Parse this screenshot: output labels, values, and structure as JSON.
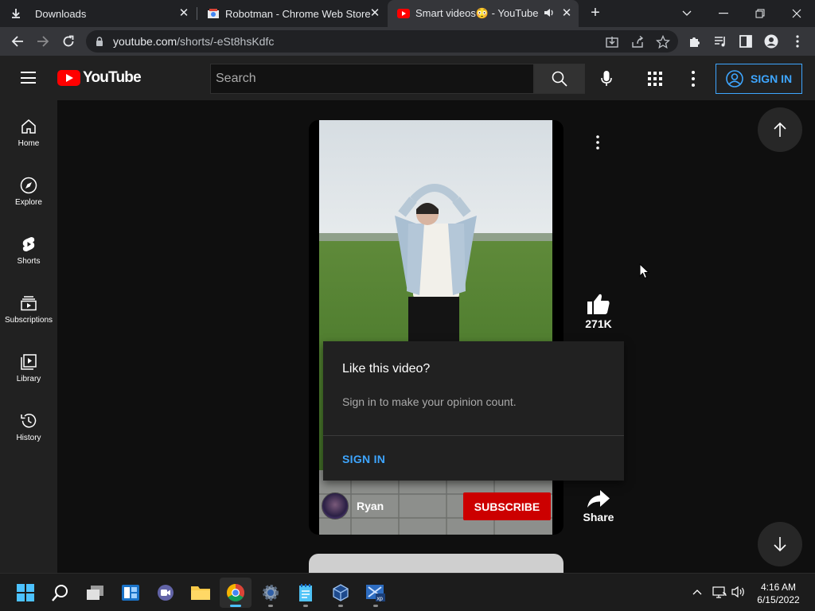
{
  "browser": {
    "tabs": [
      {
        "title": "Downloads",
        "active": false
      },
      {
        "title": "Robotman - Chrome Web Store",
        "active": false
      },
      {
        "title": "Smart videos😳 - YouTube",
        "active": true
      }
    ],
    "url_host": "youtube.com",
    "url_path": "/shorts/-eSt8hsKdfc"
  },
  "masthead": {
    "logo_text": "YouTube",
    "search_placeholder": "Search",
    "signin_label": "SIGN IN"
  },
  "sidebar": {
    "items": [
      {
        "label": "Home",
        "icon": "home-icon"
      },
      {
        "label": "Explore",
        "icon": "compass-icon"
      },
      {
        "label": "Shorts",
        "icon": "shorts-icon"
      },
      {
        "label": "Subscriptions",
        "icon": "subscriptions-icon"
      },
      {
        "label": "Library",
        "icon": "library-icon"
      },
      {
        "label": "History",
        "icon": "history-icon"
      }
    ]
  },
  "short": {
    "channel_name": "Ryan",
    "subscribe_label": "SUBSCRIBE",
    "like_count": "271K",
    "share_label": "Share"
  },
  "popup": {
    "title": "Like this video?",
    "description": "Sign in to make your opinion count.",
    "action_label": "SIGN IN"
  },
  "taskbar": {
    "time": "4:16 AM",
    "date": "6/15/2022"
  },
  "colors": {
    "accent_blue": "#3ea6ff",
    "subscribe_red": "#cc0000",
    "logo_red": "#ff0000",
    "background": "#0f0f0f",
    "surface": "#212121"
  }
}
